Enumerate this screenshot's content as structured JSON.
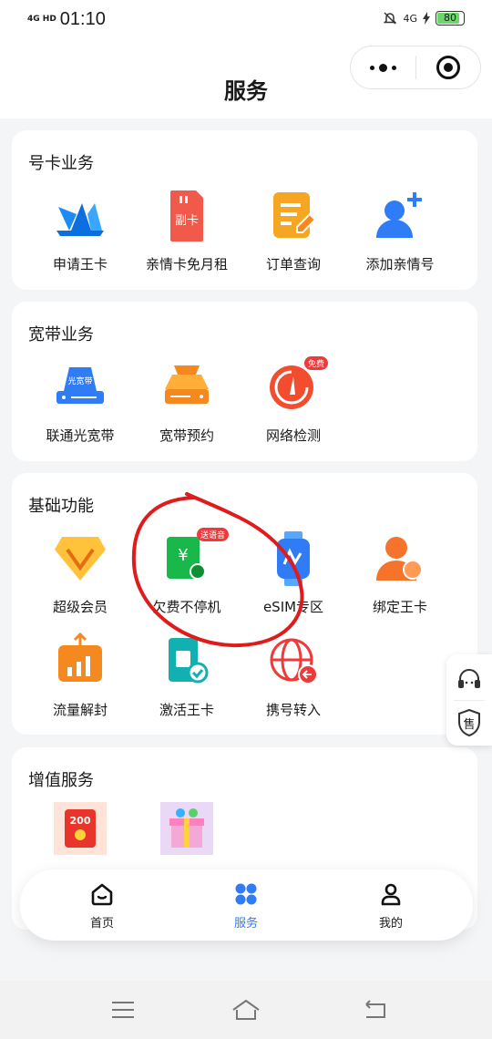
{
  "status_bar": {
    "network": "4G HD",
    "time": "01:10",
    "net_right": "4G",
    "battery": "80"
  },
  "header": {
    "title": "服务"
  },
  "sections": [
    {
      "title": "号卡业务",
      "items": [
        {
          "label": "申请王卡",
          "icon": "crown-logo-icon"
        },
        {
          "label": "亲情卡免月租",
          "icon": "sim-card-icon",
          "icon_text": "副卡"
        },
        {
          "label": "订单查询",
          "icon": "order-document-icon"
        },
        {
          "label": "添加亲情号",
          "icon": "add-user-icon"
        }
      ]
    },
    {
      "title": "宽带业务",
      "items": [
        {
          "label": "联通光宽带",
          "icon": "router-icon",
          "icon_text": "光宽带"
        },
        {
          "label": "宽带预约",
          "icon": "modem-icon"
        },
        {
          "label": "网络检测",
          "icon": "speedometer-icon",
          "badge": "免费"
        }
      ]
    },
    {
      "title": "基础功能",
      "items": [
        {
          "label": "超级会员",
          "icon": "diamond-icon"
        },
        {
          "label": "欠费不停机",
          "icon": "yuan-card-icon",
          "badge": "送语音"
        },
        {
          "label": "eSIM专区",
          "icon": "smartwatch-icon"
        },
        {
          "label": "绑定王卡",
          "icon": "user-link-icon"
        },
        {
          "label": "流量解封",
          "icon": "data-unlock-icon"
        },
        {
          "label": "激活王卡",
          "icon": "sim-activate-icon"
        },
        {
          "label": "携号转入",
          "icon": "globe-transfer-icon"
        }
      ]
    },
    {
      "title": "增值服务",
      "items": [
        {
          "label": "",
          "icon": "red-envelope-icon",
          "icon_text": "200"
        },
        {
          "label": "",
          "icon": "gift-box-icon"
        }
      ]
    }
  ],
  "float_panel": {
    "service_label": "售"
  },
  "bottom_nav": [
    {
      "label": "首页",
      "icon": "home-icon",
      "active": false
    },
    {
      "label": "服务",
      "icon": "grid-icon",
      "active": true
    },
    {
      "label": "我的",
      "icon": "profile-icon",
      "active": false
    }
  ],
  "colors": {
    "active_blue": "#2f7cf6",
    "annotation_red": "#e01b1b",
    "orange": "#f5891f"
  }
}
